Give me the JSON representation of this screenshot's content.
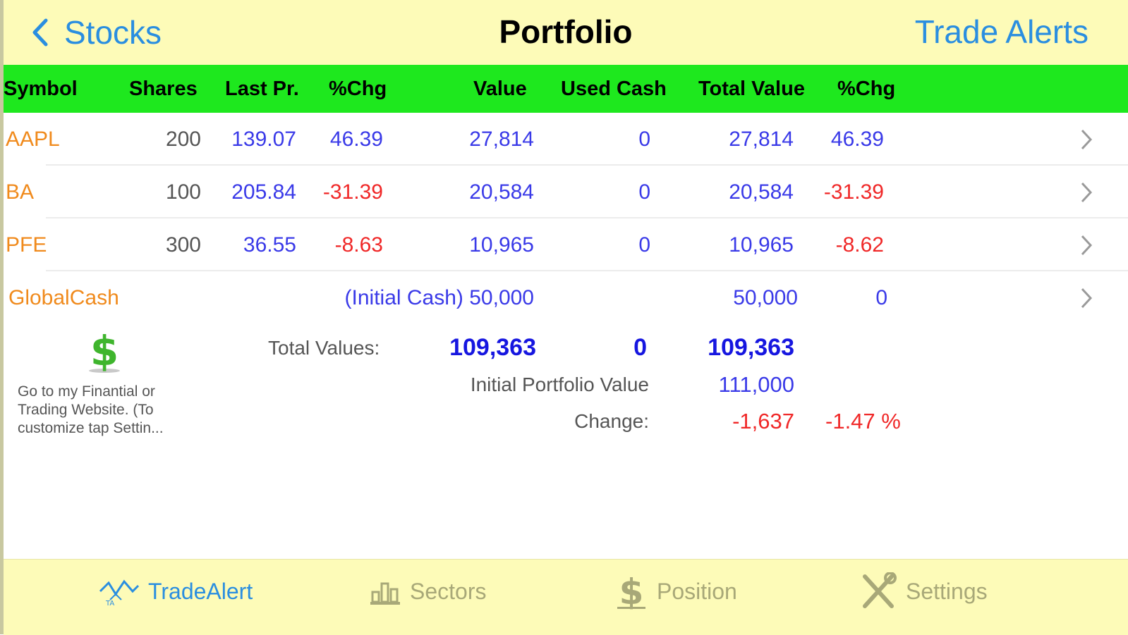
{
  "nav": {
    "back_label": "Stocks",
    "title": "Portfolio",
    "right_label": "Trade Alerts"
  },
  "table": {
    "headers": [
      "Symbol",
      "Shares",
      "Last Pr.",
      "%Chg",
      "Value",
      "Used Cash",
      "Total Value",
      "%Chg"
    ],
    "rows": [
      {
        "symbol": "AAPL",
        "shares": "200",
        "last": "139.07",
        "chg": "46.39",
        "value": "27,814",
        "used_cash": "0",
        "total_value": "27,814",
        "total_chg": "46.39"
      },
      {
        "symbol": "BA",
        "shares": "100",
        "last": "205.84",
        "chg": "-31.39",
        "value": "20,584",
        "used_cash": "0",
        "total_value": "20,584",
        "total_chg": "-31.39"
      },
      {
        "symbol": "PFE",
        "shares": "300",
        "last": "36.55",
        "chg": "-8.63",
        "value": "10,965",
        "used_cash": "0",
        "total_value": "10,965",
        "total_chg": "-8.62"
      }
    ],
    "cash_row": {
      "symbol": "GlobalCash",
      "initial": "(Initial Cash) 50,000",
      "total_value": "50,000",
      "total_chg": "0"
    }
  },
  "totals": {
    "label": "Total Values:",
    "value": "109,363",
    "used_cash": "0",
    "total_value": "109,363",
    "initial_label": "Initial Portfolio Value",
    "initial_value": "111,000",
    "change_label": "Change:",
    "change_value": "-1,637",
    "change_pct": "-1.47 %"
  },
  "website_link": "Go to my Finantial or Trading Website. (To customize tap Settin...",
  "tabs": [
    {
      "label": "TradeAlert",
      "icon": "trade-alert-icon",
      "active": true
    },
    {
      "label": "Sectors",
      "icon": "sectors-icon",
      "active": false
    },
    {
      "label": "Position",
      "icon": "dollar-icon",
      "active": false
    },
    {
      "label": "Settings",
      "icon": "settings-icon",
      "active": false
    }
  ],
  "colors": {
    "nav_bg": "#fdfbb8",
    "header_bg": "#1ee81e",
    "link_blue": "#2a8ee0",
    "symbol_orange": "#f08a1c",
    "value_blue": "#3a3ae8",
    "negative_red": "#f02828",
    "tab_inactive": "#a8a878"
  }
}
